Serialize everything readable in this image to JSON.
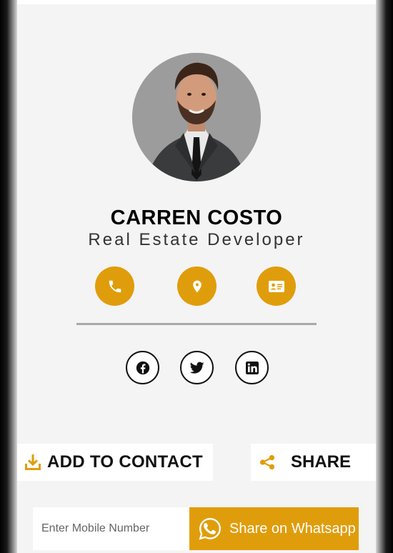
{
  "profile": {
    "name": "CARREN COSTO",
    "role": "Real Estate Developer"
  },
  "actions": {
    "call_icon": "phone-icon",
    "location_icon": "location-pin-icon",
    "contact_card_icon": "id-card-icon"
  },
  "social": {
    "facebook_icon": "facebook-icon",
    "twitter_icon": "twitter-icon",
    "linkedin_icon": "linkedin-icon"
  },
  "buttons": {
    "add_to_contact": "ADD TO CONTACT",
    "share": "SHARE"
  },
  "whatsapp": {
    "placeholder": "Enter Mobile Number",
    "button_label": "Share on Whatsapp"
  },
  "colors": {
    "accent": "#e09d0b",
    "background": "#f4f4f4"
  }
}
